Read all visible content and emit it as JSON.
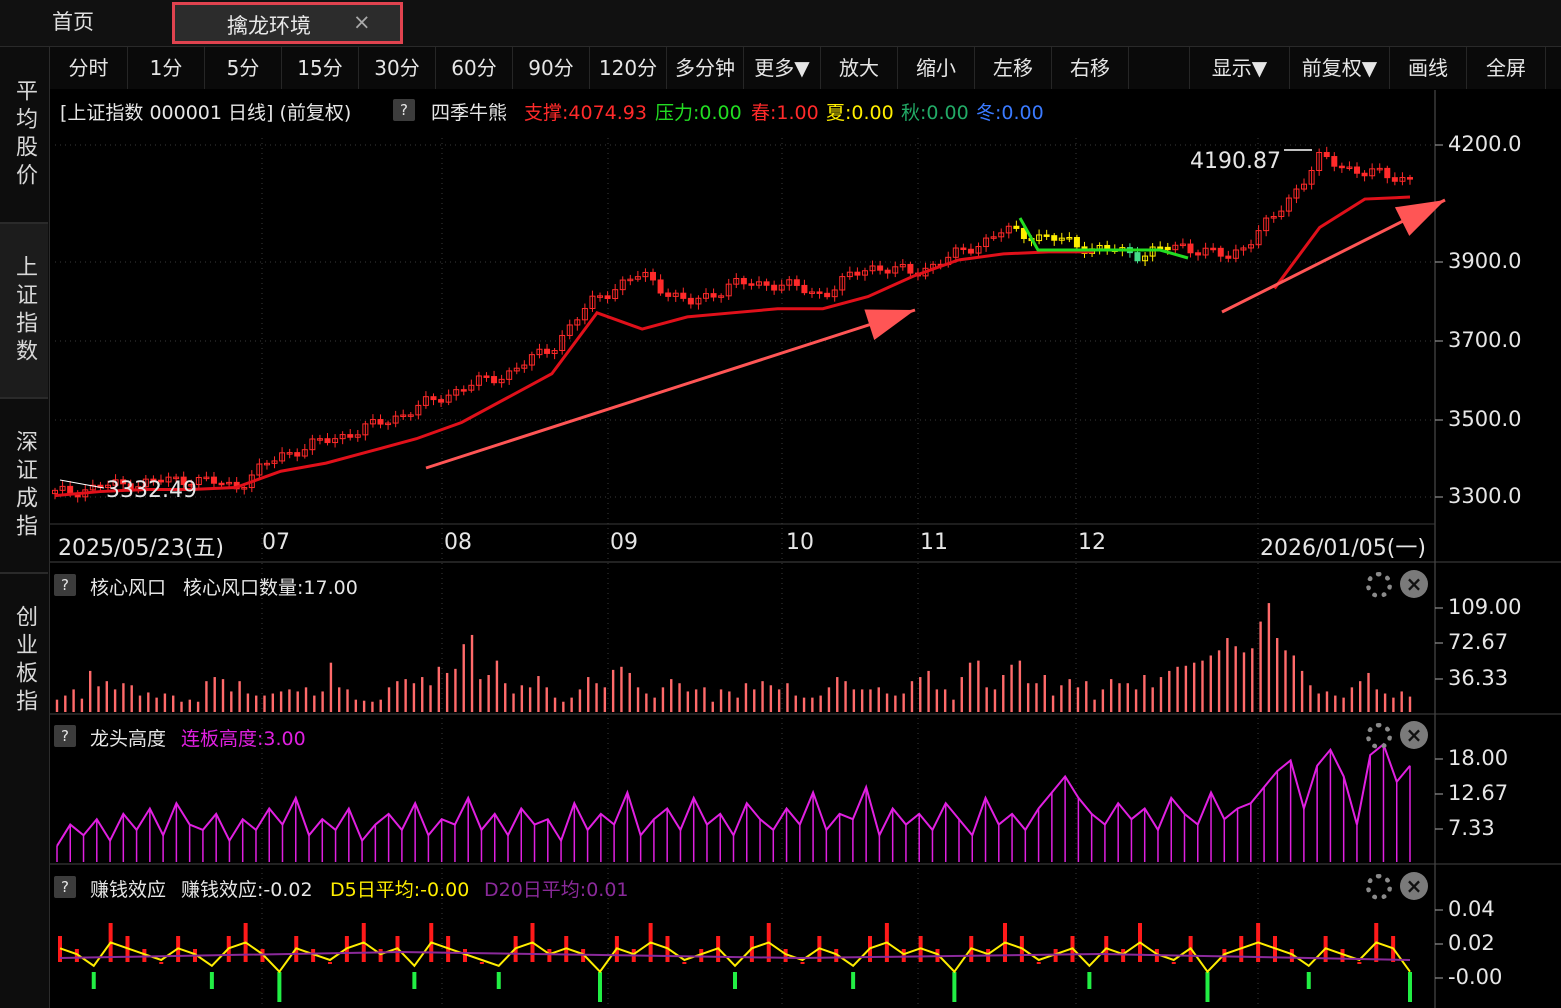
{
  "tabs": {
    "home": "首页",
    "active": "擒龙环境",
    "close": "×"
  },
  "toolbar": [
    "分时",
    "1分",
    "5分",
    "15分",
    "30分",
    "60分",
    "90分",
    "120分",
    "多分钟",
    "更多▼",
    "放大",
    "缩小",
    "左移",
    "右移",
    "",
    "显示▼",
    "前复权▼",
    "画线",
    "全屏"
  ],
  "sidebar": [
    "平均股价",
    "上证指数",
    "深证成指",
    "创业板指"
  ],
  "info": {
    "title": "[上证指数 000001 日线] (前复权)",
    "help": "?",
    "indicator": "四季牛熊",
    "support": "支撑:4074.93",
    "pressure": "压力:0.00",
    "spring": "春:1.00",
    "summer": "夏:0.00",
    "autumn": "秋:0.00",
    "winter": "冬:0.00"
  },
  "colors": {
    "up": "#ff2a2a",
    "down": "#00e0e0",
    "support_line": "#e0101a",
    "green_line": "#22dd22",
    "yellow": "#ffee00",
    "magenta": "#e020e0",
    "purple": "#8a2a9a",
    "annotation_arrow": "#ff5555"
  },
  "main_chart": {
    "y_ticks": [
      "4200.0",
      "3900.0",
      "3700.0",
      "3500.0",
      "3300.0"
    ],
    "high_label": "4190.87",
    "low_label": "3332.49",
    "x_labels": [
      "2025/05/23(五)",
      "07",
      "08",
      "09",
      "10",
      "11",
      "12",
      "2026/01/05(一)"
    ]
  },
  "panels": {
    "p1": {
      "title": "核心风口",
      "value": "核心风口数量:17.00",
      "y_ticks": [
        "109.00",
        "72.67",
        "36.33"
      ]
    },
    "p2": {
      "title": "龙头高度",
      "value": "连板高度:3.00",
      "y_ticks": [
        "18.00",
        "12.67",
        "7.33"
      ]
    },
    "p3": {
      "title": "赚钱效应",
      "value": "赚钱效应:-0.02",
      "d5": "D5日平均:-0.00",
      "d20": "D20日平均:0.01",
      "y_ticks": [
        "0.04",
        "0.02",
        "-0.00"
      ]
    }
  },
  "chart_data": [
    {
      "type": "line",
      "title": "",
      "subtitle": "",
      "x": [
        0,
        5,
        10,
        15,
        20,
        25,
        30,
        35,
        40,
        45,
        50,
        55,
        60,
        65,
        70,
        75,
        80,
        85,
        90,
        95,
        100,
        105,
        110,
        115,
        120,
        125,
        130,
        135,
        140,
        145,
        150
      ],
      "series": [
        {
          "name": "",
          "values": [
            3345,
            3362,
            3372,
            3382,
            3362,
            3440,
            3475,
            3510,
            3555,
            3605,
            3640,
            3705,
            3830,
            3885,
            3810,
            3860,
            3862,
            3835,
            3905,
            3888,
            3935,
            3992,
            3975,
            3948,
            3935,
            3955,
            3925,
            4025,
            4170,
            4135,
            4120
          ]
        },
        {
          "name": "支撑",
          "values": [
            3340,
            3350,
            3355,
            3355,
            3360,
            3400,
            3420,
            3450,
            3480,
            3520,
            3580,
            3640,
            3790,
            3750,
            3780,
            3790,
            3800,
            3800,
            3830,
            3880,
            3920,
            3935,
            3940,
            3940,
            null,
            null,
            null,
            3850,
            4000,
            4070,
            4075
          ]
        }
      ],
      "ylim": [
        3280,
        4240
      ]
    },
    {
      "type": "bar",
      "values": [
        12,
        16,
        22,
        13,
        40,
        25,
        30,
        22,
        28,
        26,
        16,
        19,
        14,
        18,
        16,
        10,
        12,
        10,
        30,
        34,
        32,
        20,
        30,
        18,
        16,
        16,
        18,
        20,
        22,
        20,
        24,
        16,
        20,
        48,
        24,
        22,
        12,
        11,
        10,
        12,
        24,
        30,
        32,
        28,
        34,
        26,
        44,
        38,
        42,
        66,
        75,
        32,
        36,
        50,
        28,
        18,
        26,
        24,
        35,
        24,
        14,
        10,
        14,
        22,
        34,
        28,
        24,
        41,
        44,
        38,
        24,
        18,
        14,
        24,
        32,
        28,
        20,
        22,
        24,
        10,
        22,
        20,
        14,
        28,
        22,
        30,
        26,
        22,
        28,
        16,
        14,
        14,
        16,
        24,
        34,
        30,
        22,
        22,
        22,
        24,
        18,
        16,
        18,
        30,
        34,
        40,
        22,
        22,
        12,
        34,
        48,
        50,
        24,
        22,
        36,
        46,
        50,
        28,
        28,
        36,
        16,
        26,
        32,
        24,
        30,
        12,
        22,
        32,
        28,
        28,
        22,
        36,
        24,
        34,
        40,
        44,
        45,
        48,
        50,
        55,
        60,
        72,
        64,
        58,
        62,
        88,
        106,
        72,
        60,
        55,
        40,
        26,
        18,
        20,
        16,
        14,
        24,
        30,
        38,
        22,
        18,
        14,
        20,
        15
      ],
      "ylim": [
        0,
        109
      ]
    },
    {
      "type": "area",
      "values": [
        3,
        7,
        5,
        8,
        4,
        9,
        6,
        10,
        5,
        11,
        7,
        6,
        9,
        4,
        8,
        6,
        10,
        7,
        12,
        5,
        8,
        6,
        10,
        4,
        7,
        9,
        6,
        11,
        5,
        8,
        7,
        12,
        6,
        9,
        5,
        10,
        7,
        8,
        4,
        11,
        6,
        9,
        7,
        13,
        5,
        8,
        10,
        6,
        12,
        7,
        9,
        5,
        11,
        8,
        6,
        10,
        7,
        13,
        6,
        9,
        8,
        14,
        5,
        10,
        7,
        9,
        6,
        11,
        8,
        5,
        12,
        7,
        9,
        6,
        10,
        13,
        16,
        12,
        9,
        7,
        11,
        8,
        10,
        6,
        12,
        9,
        7,
        13,
        8,
        10,
        11,
        14,
        17,
        19,
        10,
        18,
        21,
        16,
        7,
        20,
        22,
        15,
        18
      ],
      "ylim": [
        0,
        20
      ]
    },
    {
      "type": "bar",
      "values": [
        0.02,
        0.01,
        -0.01,
        0.03,
        0.02,
        0.01,
        0.0,
        0.02,
        0.01,
        -0.01,
        0.02,
        0.03,
        0.01,
        -0.02,
        0.02,
        0.01,
        0.0,
        0.02,
        0.03,
        0.01,
        0.02,
        -0.01,
        0.03,
        0.02,
        0.01,
        0.0,
        -0.01,
        0.02,
        0.03,
        0.01,
        0.02,
        0.01,
        -0.02,
        0.02,
        0.01,
        0.03,
        0.02,
        0.0,
        0.01,
        0.02,
        -0.01,
        0.02,
        0.03,
        0.01,
        0.0,
        0.02,
        0.01,
        -0.01,
        0.02,
        0.03,
        0.01,
        0.02,
        0.01,
        -0.02,
        0.02,
        0.01,
        0.03,
        0.02,
        0.0,
        0.01,
        0.02,
        -0.01,
        0.02,
        0.01,
        0.03,
        0.01,
        0.0,
        0.02,
        -0.02,
        0.01,
        0.02,
        0.03,
        0.02,
        0.01,
        -0.01,
        0.02,
        0.01,
        0.0,
        0.03,
        0.02,
        -0.02
      ],
      "ylim": [
        -0.015,
        0.045
      ]
    }
  ]
}
